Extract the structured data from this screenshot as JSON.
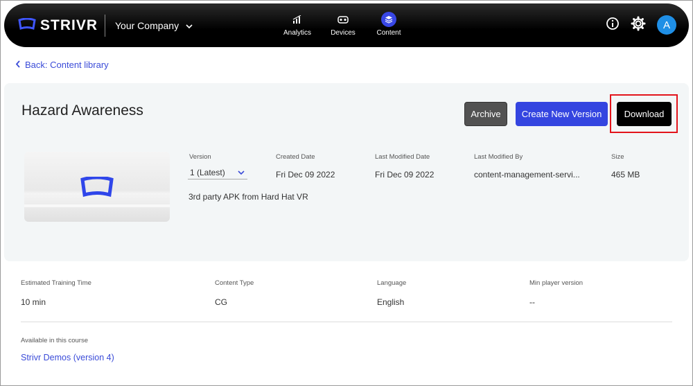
{
  "header": {
    "brand": "STRIVR",
    "company": "Your Company",
    "nav": [
      {
        "label": "Analytics",
        "icon": "bar-chart-icon"
      },
      {
        "label": "Devices",
        "icon": "vr-headset-icon"
      },
      {
        "label": "Content",
        "icon": "layers-icon"
      }
    ],
    "avatar_initial": "A"
  },
  "back_link": "Back: Content library",
  "content": {
    "title": "Hazard Awareness",
    "buttons": {
      "archive": "Archive",
      "create_new_version": "Create New Version",
      "download": "Download"
    },
    "version_label": "Version",
    "version_value": "1 (Latest)",
    "description": "3rd party APK from Hard Hat VR",
    "meta": [
      {
        "label": "Created Date",
        "value": "Fri Dec 09 2022"
      },
      {
        "label": "Last Modified Date",
        "value": "Fri Dec 09 2022"
      },
      {
        "label": "Last Modified By",
        "value": "content-management-servi..."
      },
      {
        "label": "Size",
        "value": "465 MB"
      }
    ]
  },
  "details": [
    {
      "label": "Estimated Training Time",
      "value": "10 min"
    },
    {
      "label": "Content Type",
      "value": "CG"
    },
    {
      "label": "Language",
      "value": "English"
    },
    {
      "label": "Min player version",
      "value": "--"
    }
  ],
  "course": {
    "label": "Available in this course",
    "link": "Strivr Demos (version 4)"
  },
  "colors": {
    "accent": "#3445e0",
    "highlight": "#e3141b"
  }
}
